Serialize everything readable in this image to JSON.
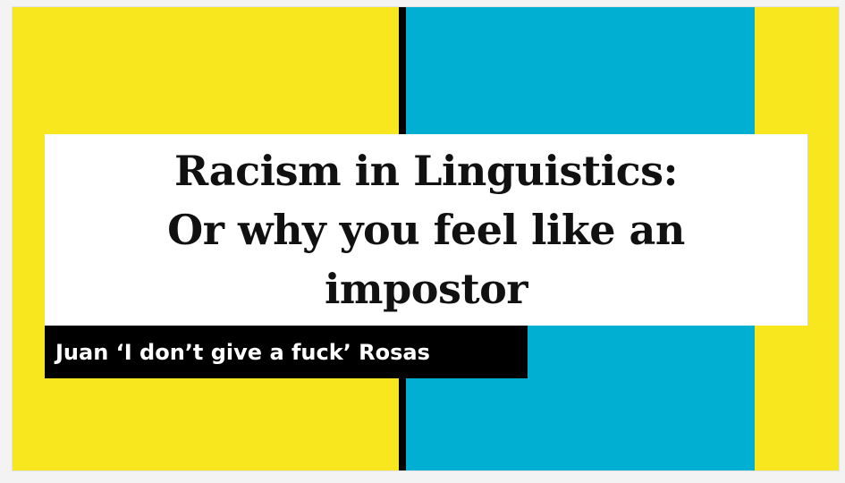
{
  "slide": {
    "title": "Racism in Linguistics:\nOr why you feel like an\nimpostor",
    "subtitle": "Juan ‘I don’t give a fuck’ Rosas"
  },
  "colors": {
    "background_yellow": "#f8e61f",
    "panel_blue": "#00afd1",
    "stripe_black": "#000000",
    "title_box_white": "#ffffff",
    "subtitle_box_black": "#000000"
  }
}
